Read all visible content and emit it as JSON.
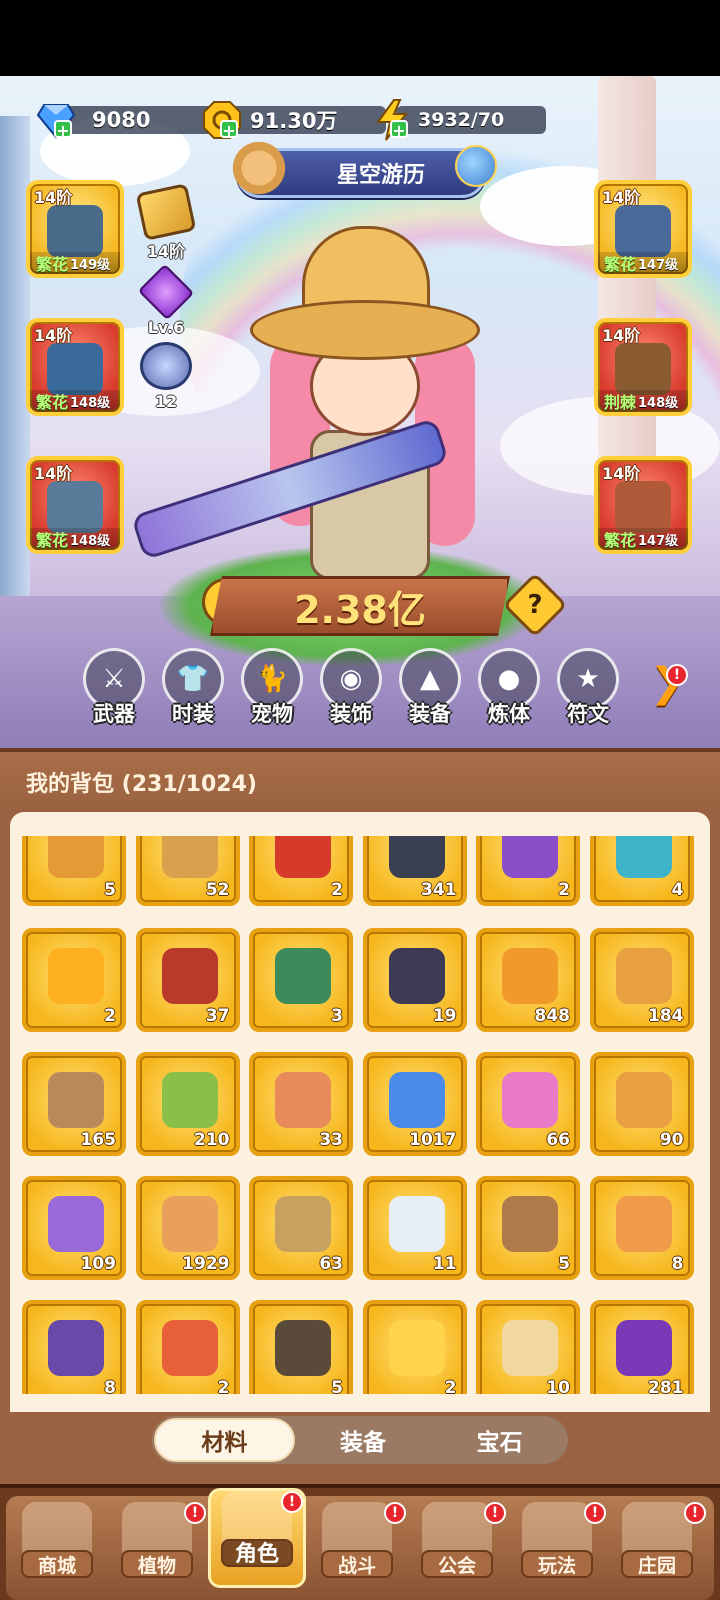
{
  "resources": {
    "diamonds": "9080",
    "gold": "91.30万",
    "energy": "3932/70"
  },
  "title_banner": "星空游历",
  "equipment": [
    {
      "tier": "14阶",
      "quality": "繁花",
      "level": "149级",
      "color": "yellow"
    },
    {
      "tier": "14阶",
      "quality": "繁花",
      "level": "148级",
      "color": "red"
    },
    {
      "tier": "14阶",
      "quality": "繁花",
      "level": "148级",
      "color": "red"
    },
    {
      "tier": "14阶",
      "quality": "繁花",
      "level": "147级",
      "color": "yellow"
    },
    {
      "tier": "14阶",
      "quality": "荆棘",
      "level": "148级",
      "color": "red"
    },
    {
      "tier": "14阶",
      "quality": "繁花",
      "level": "147级",
      "color": "red"
    }
  ],
  "side_items": [
    {
      "label": "14阶",
      "icon": "ticket-icon"
    },
    {
      "label": "Lv.6",
      "icon": "purple-gem-icon"
    },
    {
      "label": "12",
      "icon": "orb-icon"
    }
  ],
  "power": "2.38亿",
  "help_symbol": "?",
  "categories": [
    "武器",
    "时装",
    "宠物",
    "装饰",
    "装备",
    "炼体",
    "符文"
  ],
  "backpack": {
    "title": "我的背包 (231/1024)",
    "items": [
      {
        "count": "5",
        "color": "#e59a35"
      },
      {
        "count": "52",
        "color": "#d9a04e"
      },
      {
        "count": "2",
        "color": "#d63a2a"
      },
      {
        "count": "341",
        "color": "#3b3f52"
      },
      {
        "count": "2",
        "color": "#8a4fc8"
      },
      {
        "count": "4",
        "color": "#3fb4c8"
      },
      {
        "count": "2",
        "color": "#ffb020"
      },
      {
        "count": "37",
        "color": "#b83a2a"
      },
      {
        "count": "3",
        "color": "#3d8a5a"
      },
      {
        "count": "19",
        "color": "#3c3a55"
      },
      {
        "count": "848",
        "color": "#f09a2a"
      },
      {
        "count": "184",
        "color": "#e8a040"
      },
      {
        "count": "165",
        "color": "#b88a5a"
      },
      {
        "count": "210",
        "color": "#8ac04a"
      },
      {
        "count": "33",
        "color": "#e88a5a"
      },
      {
        "count": "1017",
        "color": "#4a8ae8"
      },
      {
        "count": "66",
        "color": "#e87ac8"
      },
      {
        "count": "90",
        "color": "#e8a040"
      },
      {
        "count": "109",
        "color": "#9a6ad8"
      },
      {
        "count": "1929",
        "color": "#e8a05a"
      },
      {
        "count": "63",
        "color": "#c8a060"
      },
      {
        "count": "11",
        "color": "#e8eef8"
      },
      {
        "count": "5",
        "color": "#b07a4a"
      },
      {
        "count": "8",
        "color": "#f09a4a"
      },
      {
        "count": "8",
        "color": "#6a4aa8"
      },
      {
        "count": "2",
        "color": "#e8603a"
      },
      {
        "count": "5",
        "color": "#5a4a3a"
      },
      {
        "count": "2",
        "color": "#ffd44a"
      },
      {
        "count": "10",
        "color": "#f0d8a0"
      },
      {
        "count": "281",
        "color": "#7a3ab8"
      }
    ]
  },
  "tabs": [
    "材料",
    "装备",
    "宝石"
  ],
  "active_tab": "材料",
  "bottom_nav": [
    {
      "label": "商城",
      "badge": ""
    },
    {
      "label": "植物",
      "badge": "!"
    },
    {
      "label": "角色",
      "badge": "!"
    },
    {
      "label": "战斗",
      "badge": "!"
    },
    {
      "label": "公会",
      "badge": "!"
    },
    {
      "label": "玩法",
      "badge": "!"
    },
    {
      "label": "庄园",
      "badge": "!"
    }
  ],
  "active_nav": "角色",
  "badge_symbol": "!"
}
